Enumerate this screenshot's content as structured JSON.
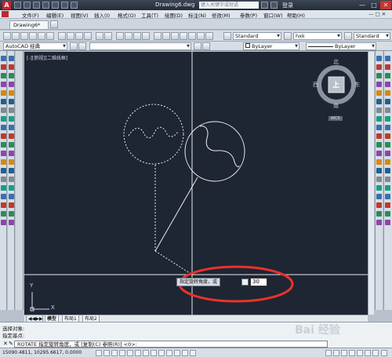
{
  "titlebar": {
    "app_icon": "A",
    "document_title": "Drawing6.dwg",
    "search_placeholder": "键入关键字或短语",
    "login_label": "登录",
    "minimize": "—",
    "maximize": "□",
    "close": "✕"
  },
  "menubar": {
    "items": [
      "文件(F)",
      "编辑(E)",
      "视图(V)",
      "插入(I)",
      "格式(O)",
      "工具(T)",
      "绘图(D)",
      "标注(N)",
      "修改(M)",
      "参数(P)",
      "窗口(W)",
      "帮助(H)"
    ]
  },
  "tabs": {
    "document_tab": "Drawing6*",
    "text_style": "Standard",
    "dim_style": "hxk",
    "table_style": "Standard"
  },
  "toolbar2": {
    "workspace": "AutoCAD 经典",
    "color": "ByLayer",
    "linetype": "ByLayer"
  },
  "canvas": {
    "viewport_label": "[-][俯视][二维线框]",
    "background": "#1e2533",
    "crosshair_color": "#e6e9ee",
    "geometry_color": "#e8ecf2",
    "annotation_circle_color": "#e8322c"
  },
  "viewcube": {
    "north": "北",
    "south": "南",
    "east": "东",
    "west": "西",
    "face": "上",
    "wcs": "WCS"
  },
  "ucs": {
    "x_label": "X",
    "y_label": "Y"
  },
  "dynamic_input": {
    "prompt": "指定旋转角度，或",
    "value": "30"
  },
  "layout_tabs": [
    "模型",
    "布局1",
    "布局2"
  ],
  "command": {
    "history": [
      "选择对象:",
      "指定基点:"
    ],
    "current": "ROTATE 指定旋转角度，或 [复制(C) 参照(R)] <0>:"
  },
  "status": {
    "coordinates": "15090.4811, 10295.6617, 0.0000"
  },
  "watermark": "Bai 经验"
}
